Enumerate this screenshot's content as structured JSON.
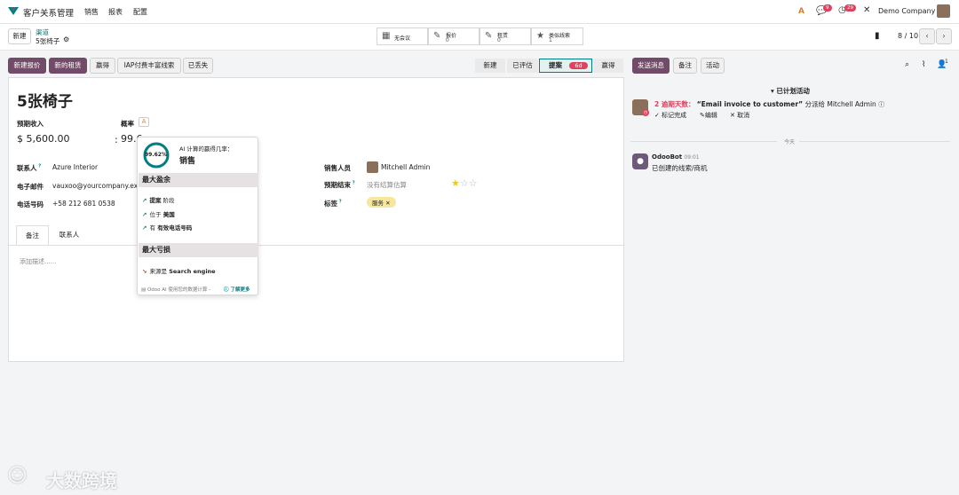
{
  "navbar": {
    "app_title": "客户关系管理",
    "menu": [
      "销售",
      "报表",
      "配置"
    ],
    "messages_badge": "9",
    "activity_badge": "29",
    "company": "Demo Company"
  },
  "control": {
    "new_label": "新建",
    "breadcrumb_parent": "渠道",
    "breadcrumb_current": "5张椅子",
    "stats": [
      {
        "icon": "calendar-icon",
        "line1": "无会议",
        "line2": ""
      },
      {
        "icon": "edit-icon",
        "line1": "报价",
        "line2": "0"
      },
      {
        "icon": "edit-icon",
        "line1": "租赁",
        "line2": "0"
      },
      {
        "icon": "star-icon",
        "line1": "类似线索",
        "line2": "1"
      }
    ],
    "pager": "8 / 10"
  },
  "actions": {
    "buttons": [
      "新建报价",
      "新的租赁",
      "赢得",
      "IAP付费丰富线索",
      "已丢失"
    ],
    "stages": [
      "新建",
      "已评估",
      "提案",
      "赢得"
    ],
    "active_stage_days": "6d",
    "chatter_buttons": [
      "发送消息",
      "备注",
      "活动"
    ],
    "follower_count": "1"
  },
  "form": {
    "title": "5张椅子",
    "expected_revenue_label": "预期收入",
    "expected_revenue": "$ 5,600.00",
    "probability_label": "概率",
    "probability_value": "99.6",
    "contact_label": "联系人",
    "contact_value": "Azure Interior",
    "email_label": "电子邮件",
    "email_value": "vauxoo@yourcompany.exa",
    "phone_label": "电话号码",
    "phone_value": "+58 212 681 0538",
    "salesperson_label": "销售人员",
    "salesperson_value": "Mitchell Admin",
    "expected_close_label": "预期结束",
    "expected_close_placeholder": "没有结算估算",
    "tags_label": "标签",
    "tag_value": "服务",
    "tabs": [
      "备注",
      "联系人"
    ],
    "notes_placeholder": "添加描述......"
  },
  "popup": {
    "percent": "99.62%",
    "header_line": "AI 计算的赢得几率：",
    "header_title": "销售",
    "section_gain": "最大盈余",
    "gains": [
      {
        "text": "提案",
        "suffix": " 阶段"
      },
      {
        "text": "位于",
        "suffix": " 美国"
      },
      {
        "text": "有",
        "suffix": " 有效电话号码"
      }
    ],
    "section_loss": "最大亏损",
    "losses": [
      {
        "text": "来源是",
        "suffix": " Search engine"
      }
    ],
    "footer": "Odoo AI 使用您的数据计算 -",
    "learn_more": "了解更多"
  },
  "chatter": {
    "planned_header": "已计划活动",
    "overdue": "2 逾期天数：",
    "activity_title": "“Email invoice to customer”",
    "assigned": "分派给 Mitchell Admin",
    "mark_done": "标记完成",
    "edit": "编辑",
    "cancel": "取消",
    "today": "今天",
    "bot_name": "OdooBot",
    "bot_time": "09:01",
    "bot_message": "已创建的线索/商机"
  },
  "watermark": "大数跨境",
  "colors": {
    "brand": "#714b67",
    "accent": "#017e84",
    "badge": "#e0415f"
  }
}
